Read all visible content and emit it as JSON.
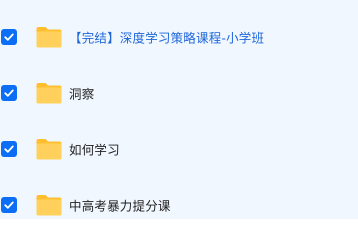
{
  "accent_color": "#0b6ef5",
  "list_background": "#f1f7ff",
  "folder_color": "#ffc83c",
  "files": [
    {
      "name": "【完结】深度学习策略课程-小学班",
      "checked": true,
      "type": "folder-icon"
    },
    {
      "name": "洞察",
      "checked": true,
      "type": "folder-icon"
    },
    {
      "name": "如何学习",
      "checked": true,
      "type": "folder-icon"
    },
    {
      "name": "中高考暴力提分课",
      "checked": true,
      "type": "folder-icon"
    }
  ]
}
